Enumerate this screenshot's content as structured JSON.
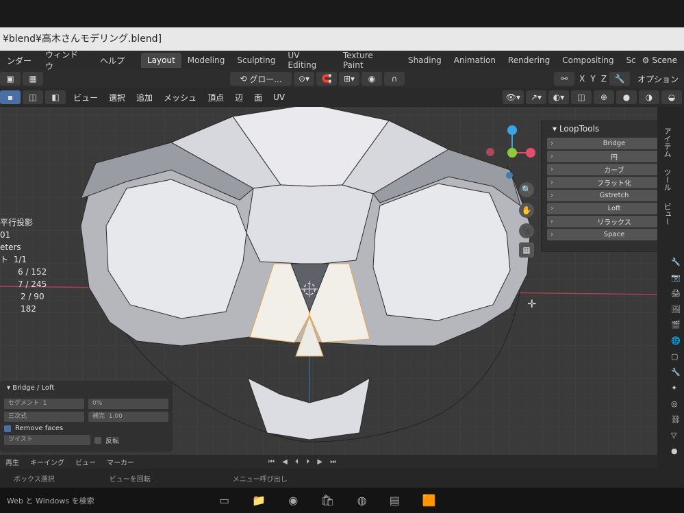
{
  "title": "¥blend¥高木さんモデリング.blend]",
  "menu": [
    "ンダー",
    "ウィンドウ",
    "ヘルプ"
  ],
  "workspaces": [
    "Layout",
    "Modeling",
    "Sculpting",
    "UV Editing",
    "Texture Paint",
    "Shading",
    "Animation",
    "Rendering",
    "Compositing",
    "Sc"
  ],
  "active_workspace": "Layout",
  "scene_label": "Scene",
  "header2": {
    "transform_orientation": "グロー...",
    "axes": [
      "X",
      "Y",
      "Z"
    ],
    "options": "オプション"
  },
  "header3": {
    "menus": [
      "ビュー",
      "選択",
      "追加",
      "メッシュ",
      "頂点",
      "辺",
      "面",
      "UV"
    ]
  },
  "stats": {
    "view": "平行投影",
    "collection": "01",
    "units": "eters",
    "objects_label": "ト",
    "objects": "1/1",
    "vertices": "6 / 152",
    "edges": "7 / 245",
    "faces": "2 / 90",
    "tris": "182"
  },
  "looptools": {
    "title": "LoopTools",
    "items": [
      "Bridge",
      "円",
      "カーブ",
      "フラット化",
      "Gstretch",
      "Loft",
      "リラックス",
      "Space"
    ]
  },
  "sidebar_tabs": [
    "アイテム",
    "ツール",
    "ビュー"
  ],
  "redo_panel": {
    "title": "Bridge / Loft",
    "row1": [
      "セグメント",
      "1",
      "0%"
    ],
    "row2": [
      "三次式",
      "補完",
      "1.00"
    ],
    "remove_faces": "Remove faces",
    "row4": [
      "ツイスト",
      "反転"
    ]
  },
  "timeline": [
    "再生",
    "キーイング",
    "ビュー",
    "マーカー"
  ],
  "statusbar": [
    "ボックス選択",
    "ビューを回転",
    "メニュー呼び出し"
  ],
  "taskbar": {
    "search": "Web と Windows を検索"
  },
  "colors": {
    "accent_orange": "#e8a34a",
    "axis_x": "#e0506a",
    "axis_y": "#8ecb3c",
    "axis_z": "#3aa4e8",
    "mesh_light": "#e6e6ea",
    "mesh_dark": "#8d8f96"
  }
}
